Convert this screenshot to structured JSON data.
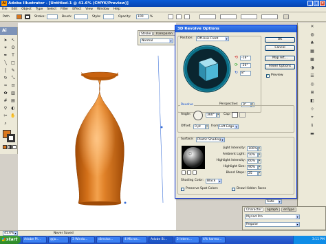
{
  "window": {
    "title": "Adobe Illustrator - [Untitled-1 @ 41.6% (CMYK/Preview)]",
    "app_icon": "Ai"
  },
  "menubar": {
    "items": [
      "File",
      "Edit",
      "Object",
      "Type",
      "Select",
      "Filter",
      "Effect",
      "View",
      "Window",
      "Help"
    ]
  },
  "controlbar": {
    "selection": "Path",
    "stroke_label": "Stroke:",
    "brush_label": "Brush:",
    "style_label": "Style:",
    "opacity_label": "Opacity:",
    "opacity_value": "100",
    "opacity_unit": "%"
  },
  "toolbox": {
    "header": "Ai"
  },
  "stroke_panel": {
    "tabs": [
      "Stroke",
      "Transparen"
    ],
    "blend_mode": "Normal"
  },
  "dialog": {
    "title": "3D Revolve Options",
    "position_label": "Position:",
    "position_value": "Off-Axis Front",
    "rot_x": "-18°",
    "rot_y": "-26°",
    "rot_z": "8°",
    "perspective_label": "Perspective:",
    "perspective_value": "0°",
    "revolve_group": "Revolve",
    "angle_label": "Angle:",
    "angle_value": "360°",
    "cap_label": "Cap:",
    "offset_label": "Offset:",
    "offset_value": "0 pt",
    "from_label": "from",
    "from_value": "Left Edge",
    "surface_group": "Surface:",
    "surface_value": "Plastic Shading",
    "light_intensity_label": "Light Intensity:",
    "light_intensity_value": "100%",
    "ambient_light_label": "Ambient Light:",
    "ambient_light_value": "50%",
    "highlight_intensity_label": "Highlight Intensity:",
    "highlight_intensity_value": "60%",
    "highlight_size_label": "Highlight Size:",
    "highlight_size_value": "90%",
    "blend_steps_label": "Blend Steps:",
    "blend_steps_value": "25",
    "shading_color_label": "Shading Color:",
    "shading_color_value": "Black",
    "preserve_spot_label": "Preserve Spot Colors",
    "draw_hidden_label": "Draw Hidden Faces",
    "ok": "OK",
    "cancel": "Cancel",
    "map_art": "Map Art...",
    "fewer_options": "Fewer Options",
    "preview_label": "Preview",
    "preview_checked": true
  },
  "right_panel": {
    "zoom_value": "Auto",
    "char_tabs": [
      "Character",
      "agraph",
      "enType"
    ],
    "font_value": "Myriad Pro",
    "style_value": "Regular"
  },
  "statusbar": {
    "zoom": "41.6%",
    "status": "Never Saved"
  },
  "taskbar": {
    "start_label": "start",
    "tasks": [
      "Adobe Pl...",
      "@jo...",
      "3 Windo...",
      "director...",
      "4 Micros...",
      "Adobe Bi...",
      "2 Intern...",
      "4% harmo..."
    ],
    "clock": "3:11 PM"
  },
  "colors": {
    "vase": "#d9771d",
    "vase_dark": "#b45608",
    "cube_face": "#4db7d6",
    "track": "#0b6f86",
    "dialog_title": "#1f5ad0",
    "xp_blue": "#1f4fc5"
  }
}
